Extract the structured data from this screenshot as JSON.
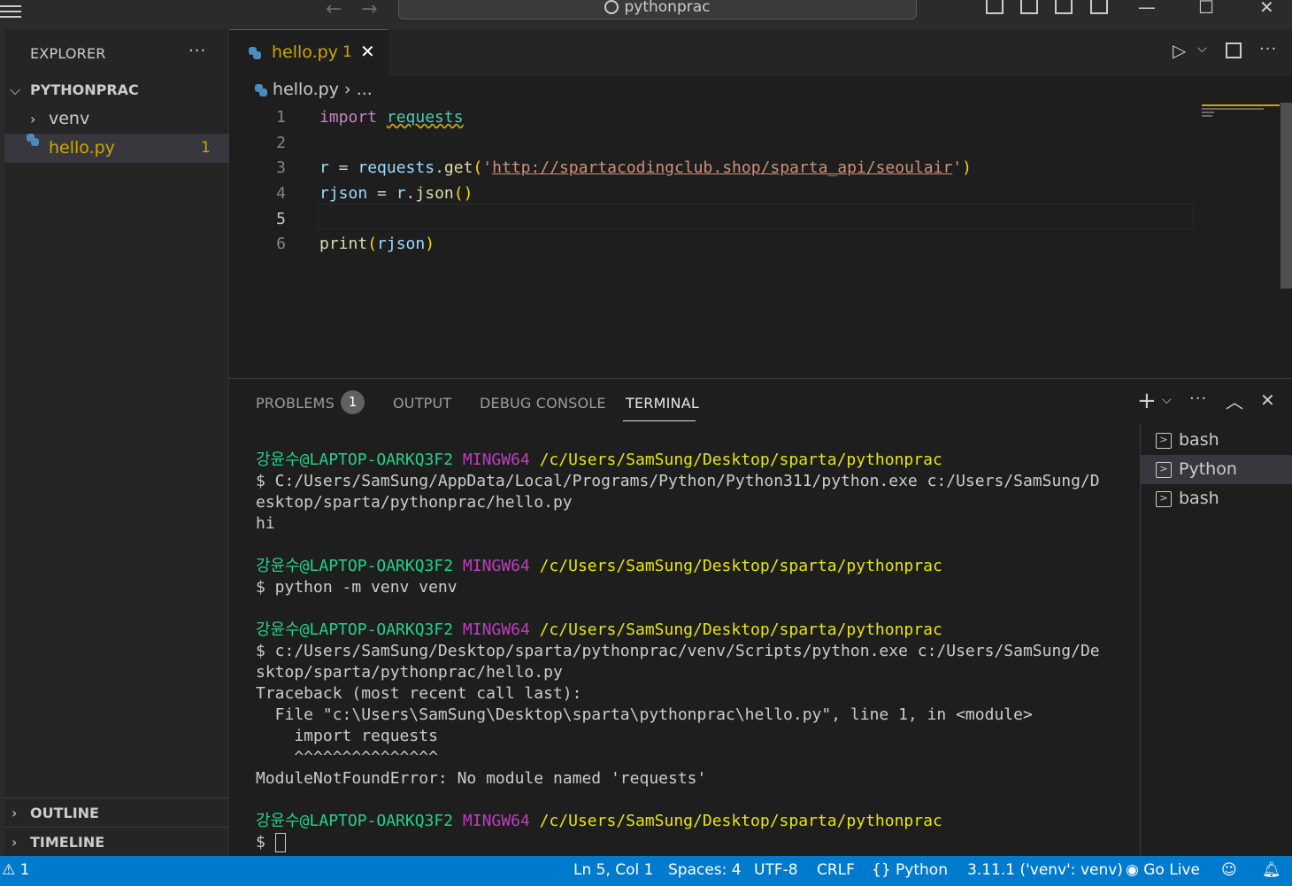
{
  "titlebar": {
    "search_text": "pythonprac",
    "nav_back": "←",
    "nav_forward": "→"
  },
  "sidebar": {
    "header": "EXPLORER",
    "more": "···",
    "folder": "PYTHONPRAC",
    "items": [
      {
        "label": "venv",
        "type": "folder"
      },
      {
        "label": "hello.py",
        "type": "file",
        "badge": "1"
      }
    ],
    "sections": [
      "OUTLINE",
      "TIMELINE"
    ]
  },
  "tab": {
    "label": "hello.py",
    "badge": "1",
    "close": "✕"
  },
  "breadcrumb": {
    "file": "hello.py",
    "sep": "›",
    "rest": "..."
  },
  "editor": {
    "line_numbers": [
      "1",
      "2",
      "3",
      "4",
      "5",
      "6"
    ],
    "line1": {
      "kw": "import",
      "mod": "requests"
    },
    "line3": {
      "var": "r",
      "eq": " = ",
      "obj": "requests",
      "dot": ".",
      "fn": "get",
      "open": "(",
      "q1": "'",
      "url": "http://spartacodingclub.shop/sparta_api/seoulair",
      "q2": "'",
      "close": ")"
    },
    "line4": {
      "var": "rjson",
      "eq": " = ",
      "obj": "r",
      "dot": ".",
      "fn": "json",
      "parens": "()"
    },
    "line6": {
      "fn": "print",
      "open": "(",
      "arg": "rjson",
      "close": ")"
    }
  },
  "panel": {
    "tabs": [
      "PROBLEMS",
      "OUTPUT",
      "DEBUG CONSOLE",
      "TERMINAL"
    ],
    "problems_badge": "1",
    "active_tab": "TERMINAL",
    "terminals": [
      "bash",
      "Python",
      "bash"
    ],
    "selected_terminal": "Python"
  },
  "terminal": {
    "user": "강윤수@LAPTOP-OARKQ3F2",
    "shell": "MINGW64",
    "path": "/c/Users/SamSung/Desktop/sparta/pythonprac",
    "blocks": [
      [
        "$ C:/Users/SamSung/AppData/Local/Programs/Python/Python311/python.exe c:/Users/SamSung/D",
        "esktop/sparta/pythonprac/hello.py",
        "hi"
      ],
      [
        "$ python -m venv venv"
      ],
      [
        "$ c:/Users/SamSung/Desktop/sparta/pythonprac/venv/Scripts/python.exe c:/Users/SamSung/De",
        "sktop/sparta/pythonprac/hello.py",
        "Traceback (most recent call last):",
        "  File \"c:\\Users\\SamSung\\Desktop\\sparta\\pythonprac\\hello.py\", line 1, in <module>",
        "    import requests",
        "    ^^^^^^^^^^^^^^^",
        "ModuleNotFoundError: No module named 'requests'"
      ]
    ],
    "prompt": "$ "
  },
  "statusbar": {
    "problems": "1",
    "position": "Ln 5, Col 1",
    "spaces": "Spaces: 4",
    "encoding": "UTF-8",
    "eol": "CRLF",
    "language": "Python",
    "interpreter": "3.11.1 ('venv': venv)",
    "golive": "Go Live"
  },
  "colors": {
    "statusbar": "#007acc",
    "warning": "#cca700",
    "terminal_user": "#23d18b",
    "terminal_shell": "#bc3fbc",
    "terminal_path": "#e5e510"
  }
}
